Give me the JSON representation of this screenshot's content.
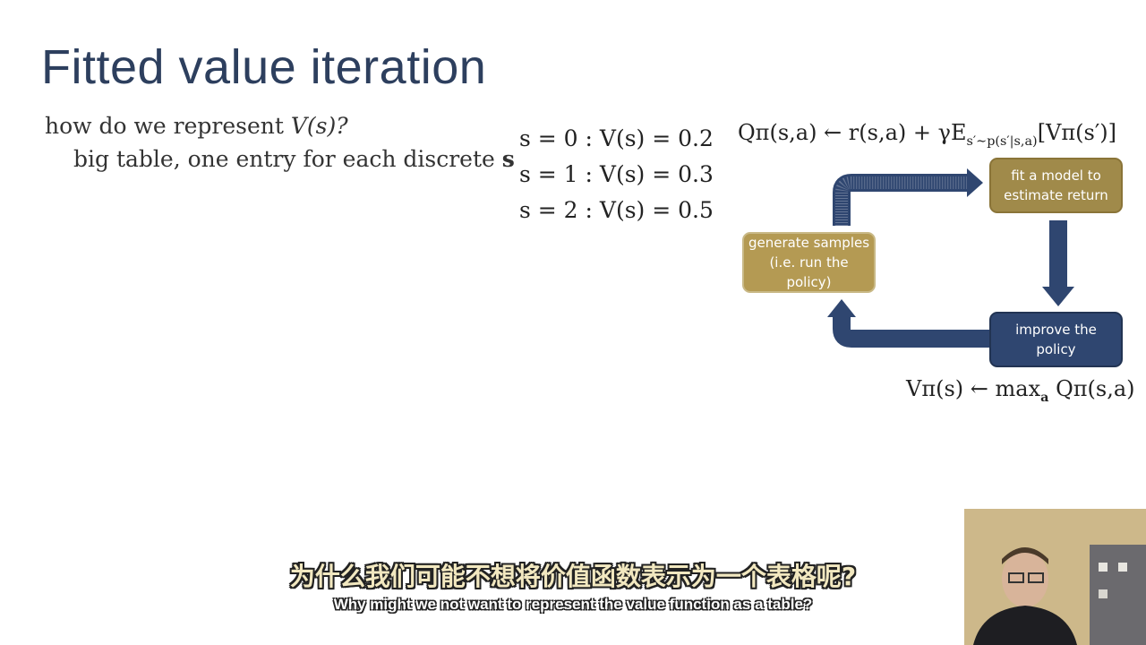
{
  "slide": {
    "title": "Fitted value iteration",
    "bullet1": {
      "text": "how do we represent ",
      "math": "V(s)?"
    },
    "bullet2": {
      "text": "big table, one entry for each discrete ",
      "math": "s"
    },
    "equations": [
      "s = 0 : V(s) = 0.2",
      "s = 1 : V(s) = 0.3",
      "s = 2 : V(s) = 0.5"
    ],
    "q_update": "Qπ(s,a) ← r(s,a) + γE",
    "q_sub": "s′∼p(s′|s,a)",
    "q_tail": "[Vπ(s′)]",
    "v_update": "Vπ(s) ← max",
    "v_sub": "a",
    "v_tail": " Qπ(s,a)"
  },
  "diagram": {
    "fit_box": "fit a model to estimate return",
    "generate_box": "generate samples (i.e. run the policy)",
    "improve_box": "improve the policy",
    "colors": {
      "gold": "#a08a4a",
      "light_gold": "#b49a53",
      "navy": "#2f4670",
      "arrow": "#2f4670"
    }
  },
  "subtitles": {
    "chinese": "为什么我们可能不想将价值函数表示为一个表格呢?",
    "english": "Why might we not want to represent the value function as a table?"
  },
  "webcam": {
    "icon": "presenter-video"
  }
}
